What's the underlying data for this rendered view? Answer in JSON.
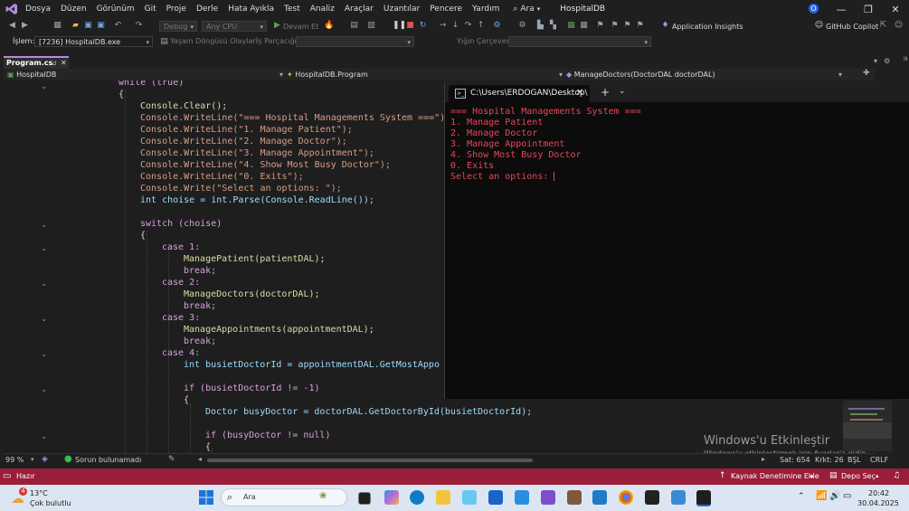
{
  "menubar": {
    "items": [
      "Dosya",
      "Düzen",
      "Görünüm",
      "Git",
      "Proje",
      "Derle",
      "Hata Ayıkla",
      "Test",
      "Analiz",
      "Araçlar",
      "Uzantılar",
      "Pencere",
      "Yardım"
    ],
    "search_label": "Ara",
    "solution_name": "HospitalDB",
    "account_initial": "O"
  },
  "toolbar": {
    "config": "Debug",
    "platform": "Any CPU",
    "continue_label": "Devam Et",
    "app_insights": "Application Insights",
    "copilot": "GitHub Copilot"
  },
  "debugbar": {
    "process_label": "İşlem:",
    "process_value": "[7236] HospitalDB.exe",
    "lifecycle_label": "Yaşam Döngüsü Olayları",
    "thread_label": "İş Parçacığı:",
    "stack_label": "Yığın Çerçevesi:"
  },
  "tabs": [
    {
      "label": "Program.cs"
    }
  ],
  "navbar": {
    "project": "HospitalDB",
    "class": "HospitalDB.Program",
    "member": "ManageDoctors(DoctorDAL doctorDAL)"
  },
  "editor": {
    "lines": [
      "while (true)",
      "{",
      "Console.Clear();",
      "Console.WriteLine(\"=== Hospital Managements System ===\");",
      "Console.WriteLine(\"1. Manage Patient\");",
      "Console.WriteLine(\"2. Manage Doctor\");",
      "Console.WriteLine(\"3. Manage Appointment\");",
      "Console.WriteLine(\"4. Show Most Busy Doctor\");",
      "Console.WriteLine(\"0. Exits\");",
      "Console.Write(\"Select an options: \");",
      "int choise = int.Parse(Console.ReadLine());",
      "switch (choise)",
      "{",
      "case 1:",
      "ManagePatient(patientDAL);",
      "break;",
      "case 2:",
      "ManageDoctors(doctorDAL);",
      "break;",
      "case 3:",
      "ManageAppointments(appointmentDAL);",
      "break;",
      "case 4:",
      "int busietDoctorId = appointmentDAL.GetMostAppo",
      "if (busietDoctorId != -1)",
      "{",
      "Doctor busyDoctor = doctorDAL.GetDoctorById(busietDoctorId);",
      "if (busyDoctor != null)",
      "{"
    ]
  },
  "terminal": {
    "tab_title": "C:\\Users\\ERDOGAN\\Desktop\\",
    "output": [
      "=== Hospital Managements System ===",
      "1. Manage Patient",
      "2. Manage Doctor",
      "3. Manage Appointment",
      "4. Show Most Busy Doctor",
      "0. Exits",
      "Select an options: "
    ]
  },
  "watermark": {
    "title": "Windows'u Etkinleştir",
    "subtitle": "Windows'u etkinleştirmek için Ayarlar'a gidin."
  },
  "editor_status": {
    "zoom": "99 %",
    "issues": "Sorun bulunamadı",
    "line": "Sat: 654",
    "col": "Krkt: 26",
    "ws": "BŞL",
    "eol": "CRLF"
  },
  "statusbar": {
    "ready": "Hazır",
    "source_control": "Kaynak Denetimine Ekle",
    "repo": "Depo Seç"
  },
  "taskbar": {
    "weather_badge": "4",
    "temperature": "13°C",
    "weather_desc": "Çok bulutlu",
    "search": "Ara",
    "time": "20:42",
    "date": "30.04.2025"
  },
  "colors": {
    "accent": "#b48bdb",
    "statusbar": "#9a1d3a",
    "terminal_text": "#e74856"
  }
}
